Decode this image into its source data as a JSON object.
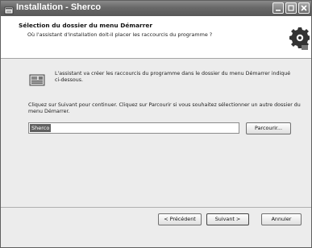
{
  "window": {
    "title": "Installation - Sherco"
  },
  "header": {
    "title": "Sélection du dossier du menu Démarrer",
    "subtitle": "Où l'assistant d'installation doit-il placer les raccourcis du programme ?"
  },
  "content": {
    "description": "L'assistant va créer les raccourcis du programme dans le dossier du menu Démarrer indiqué ci-dessous.",
    "instructions": "Cliquez sur Suivant pour continuer. Cliquez sur Parcourir si vous souhaitez sélectionner un autre dossier du menu Démarrer.",
    "folder_value": "Sherco",
    "browse_label": "Parcourir..."
  },
  "footer": {
    "previous_label": "< Précédent",
    "next_label": "Suivant >",
    "cancel_label": "Annuler"
  },
  "icons": {
    "title": "installer-icon",
    "header": "gear-icon",
    "content": "folder-shortcut-icon"
  }
}
